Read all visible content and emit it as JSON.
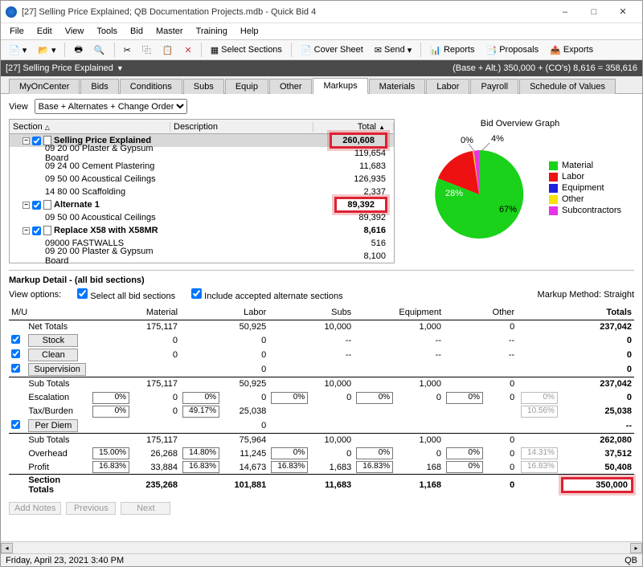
{
  "window": {
    "title": "[27] Selling Price Explained; QB Documentation Projects.mdb - Quick Bid 4"
  },
  "menus": [
    "File",
    "Edit",
    "View",
    "Tools",
    "Bid",
    "Master",
    "Training",
    "Help"
  ],
  "toolbar": {
    "select_sections": "Select Sections",
    "cover_sheet": "Cover Sheet",
    "send": "Send",
    "reports": "Reports",
    "proposals": "Proposals",
    "exports": "Exports"
  },
  "infobar": {
    "left": "[27] Selling Price Explained",
    "right": "(Base + Alt.) 350,000 + (CO's) 8,616 = 358,616"
  },
  "tabs": [
    "MyOnCenter",
    "Bids",
    "Conditions",
    "Subs",
    "Equip",
    "Other",
    "Markups",
    "Materials",
    "Labor",
    "Payroll",
    "Schedule of Values"
  ],
  "active_tab": "Markups",
  "view_label": "View",
  "view_value": "Base + Alternates + Change Orders",
  "grid_headers": {
    "section": "Section",
    "description": "Description",
    "total": "Total"
  },
  "grid": [
    {
      "type": "head",
      "label": "Selling Price Explained",
      "total": "260,608",
      "hl": true,
      "checked": true
    },
    {
      "type": "item",
      "label": "09 20 00 Plaster & Gypsum Board",
      "total": "119,654"
    },
    {
      "type": "item",
      "label": "09 24 00 Cement Plastering",
      "total": "11,683"
    },
    {
      "type": "item",
      "label": "09 50 00 Acoustical Ceilings",
      "total": "126,935"
    },
    {
      "type": "item",
      "label": "14 80 00 Scaffolding",
      "total": "2,337"
    },
    {
      "type": "head",
      "label": "Alternate 1",
      "total": "89,392",
      "hl": true,
      "checked": true
    },
    {
      "type": "item",
      "label": "09 50 00 Acoustical Ceilings",
      "total": "89,392"
    },
    {
      "type": "head",
      "label": "Replace X58 with X58MR",
      "total": "8,616",
      "checked": true
    },
    {
      "type": "item",
      "label": "09000 FASTWALLS",
      "total": "516"
    },
    {
      "type": "item",
      "label": "09 20 00 Plaster & Gypsum Board",
      "total": "8,100"
    }
  ],
  "chart_data": {
    "type": "pie",
    "title": "Bid Overview Graph",
    "series": [
      {
        "name": "Material",
        "value": 67,
        "color": "#19d219"
      },
      {
        "name": "Labor",
        "value": 28,
        "color": "#e11"
      },
      {
        "name": "Equipment",
        "value": 0,
        "color": "#2222dd"
      },
      {
        "name": "Other",
        "value": 0,
        "color": "#f5e50a"
      },
      {
        "name": "Subcontractors",
        "value": 4,
        "color": "#e733e7"
      }
    ],
    "labels": {
      "material": "67%",
      "labor": "28%",
      "sub": "4%",
      "other": "0%"
    }
  },
  "markup": {
    "title": "Markup Detail - (all bid sections)",
    "viewopts": "View options:",
    "opt1": "Select all bid sections",
    "opt2": "Include accepted alternate sections",
    "method": "Markup Method: Straight",
    "cols": {
      "mu": "M/U",
      "material": "Material",
      "labor": "Labor",
      "subs": "Subs",
      "equipment": "Equipment",
      "other": "Other",
      "totals": "Totals"
    },
    "btns": {
      "stock": "Stock",
      "clean": "Clean",
      "supervision": "Supervision",
      "perdiem": "Per Diem"
    },
    "rows": {
      "net": {
        "label": "Net Totals",
        "material": "175,117",
        "labor": "50,925",
        "subs": "10,000",
        "equipment": "1,000",
        "other": "0",
        "totals": "237,042"
      },
      "stock": {
        "material": "0",
        "labor": "0",
        "subs": "--",
        "equipment": "--",
        "other": "--",
        "totals": "0"
      },
      "clean": {
        "material": "0",
        "labor": "0",
        "subs": "--",
        "equipment": "--",
        "other": "--",
        "totals": "0"
      },
      "super": {
        "labor": "0",
        "totals": "0"
      },
      "sub1": {
        "label": "Sub Totals",
        "material": "175,117",
        "labor": "50,925",
        "subs": "10,000",
        "equipment": "1,000",
        "other": "0",
        "totals": "237,042"
      },
      "escal": {
        "label": "Escalation",
        "pct_m": "0%",
        "material": "0",
        "pct_l": "0%",
        "labor": "0",
        "pct_s": "0%",
        "subs": "0",
        "pct_e": "0%",
        "equipment": "0",
        "pct_o": "0%",
        "other": "0",
        "pct_t": "0%",
        "totals": "0"
      },
      "tax": {
        "label": "Tax/Burden",
        "pct_m": "0%",
        "material": "0",
        "pct_l": "49.17%",
        "labor": "25,038",
        "pct_t": "10.56%",
        "totals": "25,038"
      },
      "perdiem": {
        "labor": "0",
        "totals": "--"
      },
      "sub2": {
        "label": "Sub Totals",
        "material": "175,117",
        "labor": "75,964",
        "subs": "10,000",
        "equipment": "1,000",
        "other": "0",
        "totals": "262,080"
      },
      "ovh": {
        "label": "Overhead",
        "pct_m": "15.00%",
        "material": "26,268",
        "pct_l": "14.80%",
        "labor": "11,245",
        "pct_s": "0%",
        "subs": "0",
        "pct_e": "0%",
        "equipment": "0",
        "pct_o": "0%",
        "other": "0",
        "pct_t": "14.31%",
        "totals": "37,512"
      },
      "profit": {
        "label": "Profit",
        "pct_m": "16.83%",
        "material": "33,884",
        "pct_l": "16.83%",
        "labor": "14,673",
        "pct_s": "16.83%",
        "subs": "1,683",
        "pct_e": "16.83%",
        "equipment": "168",
        "pct_o": "0%",
        "other": "0",
        "pct_t": "16.83%",
        "totals": "50,408"
      },
      "sect": {
        "label": "Section Totals",
        "material": "235,268",
        "labor": "101,881",
        "subs": "11,683",
        "equipment": "1,168",
        "other": "0",
        "totals": "350,000"
      }
    },
    "footer_btns": {
      "addnotes": "Add Notes",
      "prev": "Previous",
      "next": "Next"
    }
  },
  "status": {
    "left": "Friday, April 23, 2021 3:40 PM",
    "right": "QB"
  }
}
